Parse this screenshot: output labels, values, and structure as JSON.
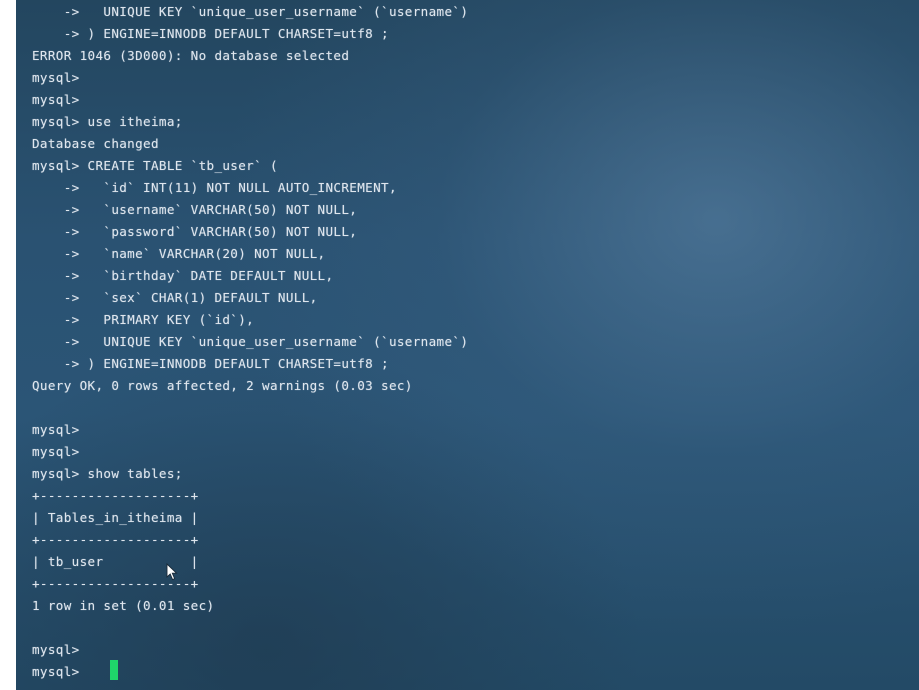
{
  "terminal": {
    "lines": [
      "    ->   UNIQUE KEY `unique_user_username` (`username`)",
      "    -> ) ENGINE=INNODB DEFAULT CHARSET=utf8 ;",
      "ERROR 1046 (3D000): No database selected",
      "mysql>",
      "mysql>",
      "mysql> use itheima;",
      "Database changed",
      "mysql> CREATE TABLE `tb_user` (",
      "    ->   `id` INT(11) NOT NULL AUTO_INCREMENT,",
      "    ->   `username` VARCHAR(50) NOT NULL,",
      "    ->   `password` VARCHAR(50) NOT NULL,",
      "    ->   `name` VARCHAR(20) NOT NULL,",
      "    ->   `birthday` DATE DEFAULT NULL,",
      "    ->   `sex` CHAR(1) DEFAULT NULL,",
      "    ->   PRIMARY KEY (`id`),",
      "    ->   UNIQUE KEY `unique_user_username` (`username`)",
      "    -> ) ENGINE=INNODB DEFAULT CHARSET=utf8 ;",
      "Query OK, 0 rows affected, 2 warnings (0.03 sec)",
      "",
      "mysql>",
      "mysql>",
      "mysql> show tables;",
      "+-------------------+",
      "| Tables_in_itheima |",
      "+-------------------+",
      "| tb_user           |",
      "+-------------------+",
      "1 row in set (0.01 sec)",
      "",
      "mysql>",
      "mysql> "
    ]
  },
  "colors": {
    "text": "#dfe6ee",
    "cursor": "#1fd46a",
    "background": "#2a5272"
  },
  "icons": {
    "pointer": "mouse-pointer-icon"
  }
}
